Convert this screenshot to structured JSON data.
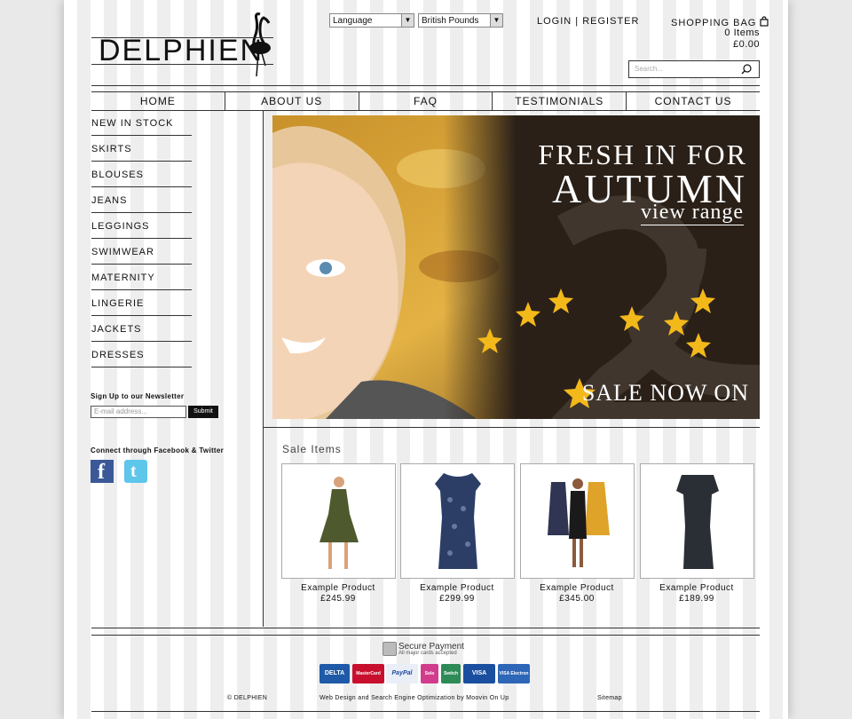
{
  "header": {
    "logo_text": "DELPHIEN",
    "language_label": "Language",
    "currency_label": "British Pounds",
    "login_label": "LOGIN",
    "separator": "|",
    "register_label": "REGISTER",
    "bag_label": "SHOPPING BAG",
    "bag_items": "0 Items",
    "bag_total": "£0.00",
    "search_placeholder": "Search..."
  },
  "nav": [
    "HOME",
    "ABOUT US",
    "FAQ",
    "TESTIMONIALS",
    "CONTACT US"
  ],
  "categories": [
    "NEW IN STOCK",
    "SKIRTS",
    "BLOUSES",
    "JEANS",
    "LEGGINGS",
    "SWIMWEAR",
    "MATERNITY",
    "LINGERIE",
    "JACKETS",
    "DRESSES"
  ],
  "newsletter": {
    "title": "Sign Up to our Newsletter",
    "email_placeholder": "E-mail address...",
    "submit_label": "Submit"
  },
  "social": {
    "title": "Connect through Facebook & Twitter",
    "icons": [
      "facebook-icon",
      "twitter-icon"
    ]
  },
  "banner": {
    "line1": "FRESH IN FOR",
    "line2": "AUTUMN",
    "line3": "view range",
    "sale": "SALE NOW ON"
  },
  "sale": {
    "title": "Sale Items",
    "products": [
      {
        "name": "Example Product",
        "price": "£245.99",
        "color": "#4e5a2d"
      },
      {
        "name": "Example Product",
        "price": "£299.99",
        "color": "#2c3e66"
      },
      {
        "name": "Example Product",
        "price": "£345.00",
        "color": "#1a1a1a"
      },
      {
        "name": "Example Product",
        "price": "£189.99",
        "color": "#2a2f36"
      }
    ]
  },
  "footer": {
    "secure_title": "Secure Payment",
    "secure_sub": "All major cards accepted",
    "cards": [
      "DELTA",
      "MasterCard",
      "PayPal",
      "Solo",
      "Switch",
      "VISA",
      "VISA Electron"
    ],
    "copyright": "© DELPHIEN",
    "credit": "Web Design and Search Engine Optimization by Moovin On Up",
    "sitemap": "Sitemap"
  }
}
